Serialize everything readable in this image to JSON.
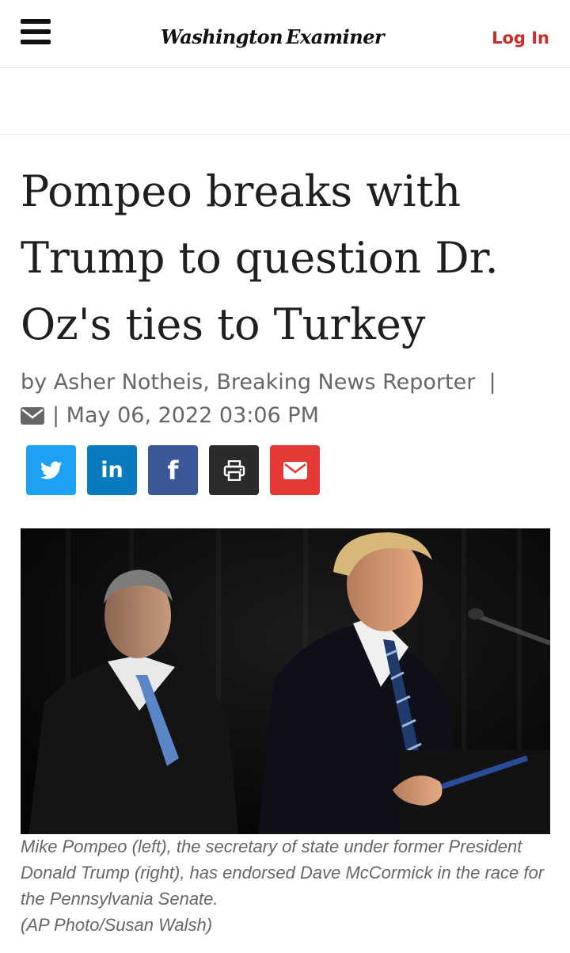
{
  "header": {
    "logo_left": "Washington",
    "logo_right": "Examiner",
    "login_label": "Log In",
    "menu_icon": "hamburger-icon"
  },
  "article": {
    "headline_lines": [
      "Pompeo breaks with",
      "Trump to question Dr.",
      "Oz's ties to Turkey"
    ],
    "byline_text": "by Asher Notheis, Breaking News Reporter  |",
    "date_text": "| May 06, 2022 03:06 PM"
  },
  "share": {
    "buttons": [
      {
        "name": "twitter",
        "icon": "twitter-icon",
        "color": "#1da1f2"
      },
      {
        "name": "linkedin",
        "icon": "linkedin-icon",
        "label": "in",
        "color": "#0a7bbf"
      },
      {
        "name": "facebook",
        "icon": "facebook-icon",
        "label": "f",
        "color": "#3b5998"
      },
      {
        "name": "print",
        "icon": "print-icon",
        "color": "#2b2b2b"
      },
      {
        "name": "email",
        "icon": "envelope-icon",
        "color": "#e53935"
      }
    ]
  },
  "photo": {
    "caption_lines": [
      "Mike Pompeo (left), the secretary of state under former President",
      "Donald Trump (right), has endorsed Dave McCormick in the race for",
      "the Pennsylvania Senate."
    ],
    "credit": "(AP Photo/Susan Walsh)"
  },
  "colors": {
    "accent_red": "#cc2b2b",
    "text_gray": "#666666"
  }
}
